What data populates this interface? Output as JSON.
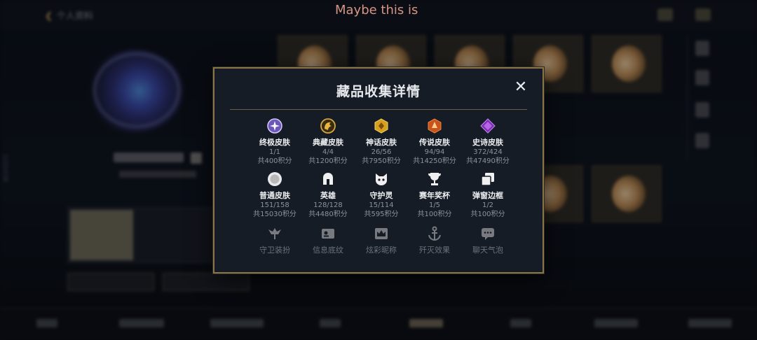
{
  "overlay_title": "Maybe this is",
  "background": {
    "back_label": "个人资料",
    "side_number": "1222436"
  },
  "modal": {
    "title": "藏品收集详情",
    "close_icon": "close-icon",
    "accent_color": "#8a7548",
    "rows": [
      [
        {
          "name": "终极皮肤",
          "count": "1/1",
          "points": "共400积分",
          "icon": "ultimate-skin-icon"
        },
        {
          "name": "典藏皮肤",
          "count": "4/4",
          "points": "共1200积分",
          "icon": "collectors-skin-icon"
        },
        {
          "name": "神话皮肤",
          "count": "26/56",
          "points": "共7950积分",
          "icon": "mythic-skin-icon"
        },
        {
          "name": "传说皮肤",
          "count": "94/94",
          "points": "共14250积分",
          "icon": "legendary-skin-icon"
        },
        {
          "name": "史诗皮肤",
          "count": "372/424",
          "points": "共47490积分",
          "icon": "epic-skin-icon"
        }
      ],
      [
        {
          "name": "普通皮肤",
          "count": "151/158",
          "points": "共15030积分",
          "icon": "normal-skin-icon"
        },
        {
          "name": "英雄",
          "count": "128/128",
          "points": "共4480积分",
          "icon": "hero-helmet-icon"
        },
        {
          "name": "守护灵",
          "count": "15/114",
          "points": "共595积分",
          "icon": "guardian-spirit-icon"
        },
        {
          "name": "赛年奖杯",
          "count": "1/5",
          "points": "共100积分",
          "icon": "trophy-icon"
        },
        {
          "name": "弹窗边框",
          "count": "1/2",
          "points": "共100积分",
          "icon": "popup-frame-icon"
        }
      ],
      [
        {
          "name": "守卫装扮",
          "icon": "ward-skin-icon"
        },
        {
          "name": "信息底纹",
          "icon": "info-card-icon"
        },
        {
          "name": "炫彩昵称",
          "icon": "crown-nickname-icon"
        },
        {
          "name": "歼灭效果",
          "icon": "anchor-effect-icon"
        },
        {
          "name": "聊天气泡",
          "icon": "chat-bubble-icon"
        }
      ]
    ]
  }
}
